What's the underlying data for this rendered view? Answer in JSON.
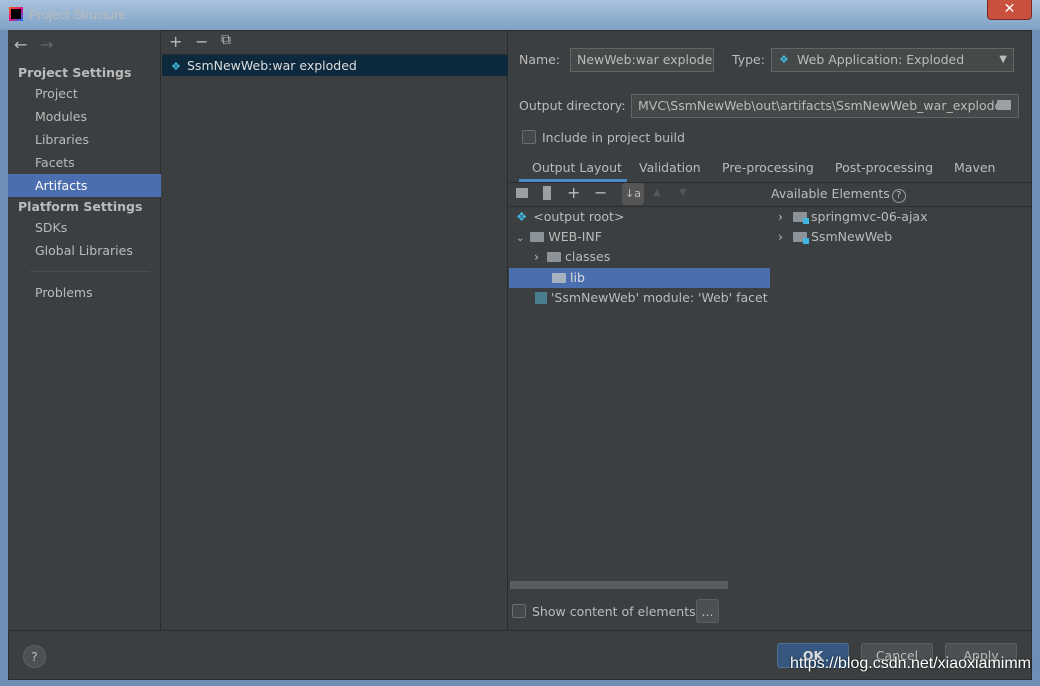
{
  "window": {
    "title": "Project Structure",
    "close": "✕"
  },
  "sidebar": {
    "back": "←",
    "forward": "→",
    "project_settings": "Project Settings",
    "items": [
      "Project",
      "Modules",
      "Libraries",
      "Facets",
      "Artifacts"
    ],
    "platform_settings": "Platform Settings",
    "platform_items": [
      "SDKs",
      "Global Libraries"
    ],
    "problems": "Problems",
    "selected": "Artifacts"
  },
  "artifacts": {
    "add": "+",
    "remove": "−",
    "copy": "⧉",
    "items": [
      "SsmNewWeb:war exploded"
    ]
  },
  "form": {
    "name_label": "Name:",
    "name_value": "NewWeb:war exploded",
    "type_label": "Type:",
    "type_value": "Web Application: Exploded",
    "output_label": "Output directory:",
    "output_value": "MVC\\SsmNewWeb\\out\\artifacts\\SsmNewWeb_war_exploded",
    "include_label": "Include in project build",
    "include_checked": false
  },
  "tabs": [
    "Output Layout",
    "Validation",
    "Pre-processing",
    "Post-processing",
    "Maven"
  ],
  "active_tab": "Output Layout",
  "layout": {
    "tree": [
      "<output root>",
      "WEB-INF",
      "classes",
      "lib",
      "'SsmNewWeb' module: 'Web' facet re"
    ],
    "available_label": "Available Elements",
    "available": [
      "springmvc-06-ajax",
      "SsmNewWeb"
    ],
    "show_content_label": "Show content of elements",
    "more": "..."
  },
  "footer": {
    "help": "?",
    "ok": "OK",
    "cancel": "Cancel",
    "apply": "Apply"
  },
  "watermark": "https://blog.csdn.net/xiaoxiamimm",
  "colors": {
    "selection": "#4b6eaf",
    "accent": "#4a88c7",
    "background": "#3c3f41"
  }
}
